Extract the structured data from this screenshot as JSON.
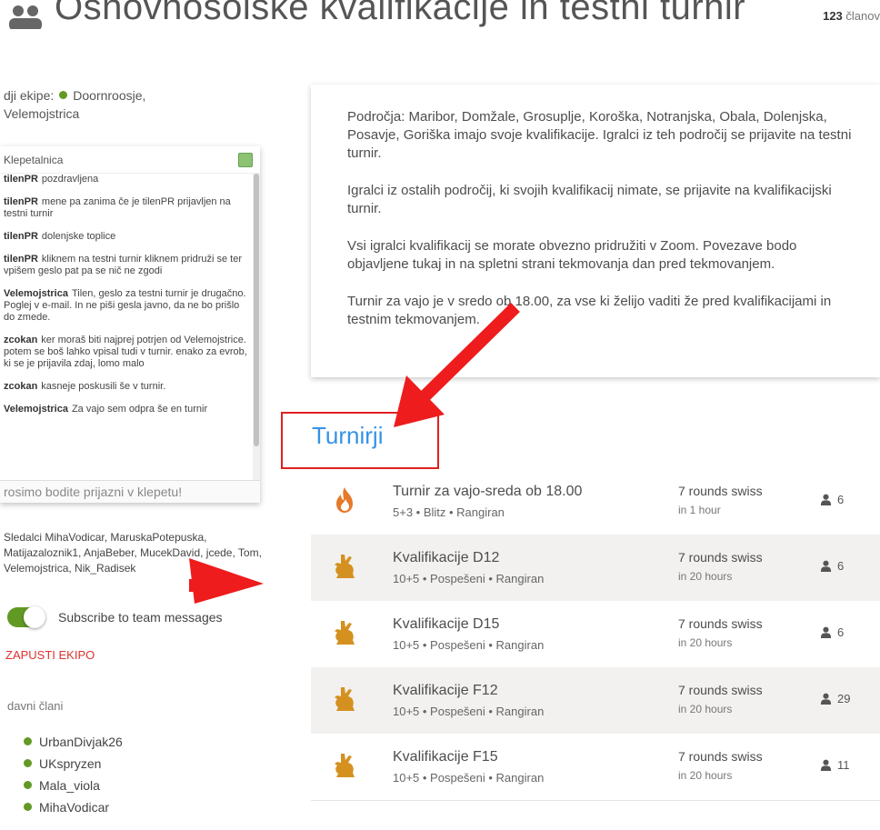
{
  "header": {
    "title": "Osnovnošolske kvalifikacije in testni turnir",
    "members_count": "123",
    "members_suffix": " članov"
  },
  "leaders": {
    "label": "dji ekipe:",
    "names": [
      "Doornroosje,",
      "Velemojstrica"
    ]
  },
  "chat": {
    "title": "Klepetalnica",
    "placeholder": "rosimo bodite prijazni v klepetu!",
    "lines": [
      {
        "user": "tilenPR",
        "text": "pozdravljena"
      },
      {
        "user": "tilenPR",
        "text": "mene pa zanima če je tilenPR prijavljen na testni turnir"
      },
      {
        "user": "tilenPR",
        "text": "dolenjske toplice"
      },
      {
        "user": "tilenPR",
        "text": "kliknem na testni turnir kliknem pridruži se ter vpišem geslo pat pa se nič ne zgodi"
      },
      {
        "user": "Velemojstrica",
        "text": "Tilen, geslo za testni turnir je drugačno. Poglej v e-mail. In ne piši gesla javno, da ne bo prišlo do zmede."
      },
      {
        "user": "zcokan",
        "text": "ker moraš biti najprej potrjen od Velemojstrice. potem se boš lahko vpisal tudi v turnir. enako za evrob, ki se je prijavila zdaj, lomo malo"
      },
      {
        "user": "zcokan",
        "text": "kasneje poskusili še v turnir."
      },
      {
        "user": "Velemojstrica",
        "text": "Za vajo sem odpra še en turnir"
      }
    ]
  },
  "followers": {
    "text": "Sledalci MihaVodicar, MaruskaPotepuska, Matijazaloznik1, AnjaBeber, MucekDavid, jcede, Tom, Velemojstrica, Nik_Radisek"
  },
  "subscribe": {
    "label": "Subscribe to team messages",
    "on": true
  },
  "zapusti": {
    "label": "ZAPUSTI EKIPO"
  },
  "members_section": {
    "title": "davni člani",
    "list": [
      "UrbanDivjak26",
      "UKspryzen",
      "Mala_viola",
      "MihaVodicar"
    ]
  },
  "description": {
    "paragraphs": [
      "Področja: Maribor, Domžale, Grosuplje, Koroška, Notranjska, Obala, Dolenjska, Posavje, Goriška imajo svoje kvalifikacije. Igralci iz teh področij se prijavite na testni turnir.",
      "Igralci iz ostalih področij, ki svojih kvalifikacij nimate, se prijavite na kvalifikacijski turnir.",
      "Vsi igralci kvalifikacij se morate obvezno pridružiti v Zoom. Povezave bodo objavljene tukaj in na spletni strani tekmovanja dan pred tekmovanjem.",
      "Turnir za vajo je v sredo ob 18.00, za vse ki želijo vaditi že pred kvalifikacijami in testnim tekmovanjem."
    ]
  },
  "tournaments": {
    "heading": "Turnirji",
    "colors": {
      "icon": "#d59120",
      "fire": "#e6792b"
    },
    "rows": [
      {
        "icon": "fire-icon",
        "name": "Turnir za vajo-sreda ob 18.00",
        "sub": "5+3 • Blitz • Rangiran",
        "format": "7 rounds swiss",
        "time": "in 1 hour",
        "players": "6"
      },
      {
        "icon": "rabbit-icon",
        "name": "Kvalifikacije D12",
        "sub": "10+5 • Pospešeni • Rangiran",
        "format": "7 rounds swiss",
        "time": "in 20 hours",
        "players": "6"
      },
      {
        "icon": "rabbit-icon",
        "name": "Kvalifikacije D15",
        "sub": "10+5 • Pospešeni • Rangiran",
        "format": "7 rounds swiss",
        "time": "in 20 hours",
        "players": "6"
      },
      {
        "icon": "rabbit-icon",
        "name": "Kvalifikacije F12",
        "sub": "10+5 • Pospešeni • Rangiran",
        "format": "7 rounds swiss",
        "time": "in 20 hours",
        "players": "29"
      },
      {
        "icon": "rabbit-icon",
        "name": "Kvalifikacije F15",
        "sub": "10+5 • Pospešeni • Rangiran",
        "format": "7 rounds swiss",
        "time": "in 20 hours",
        "players": "11"
      }
    ]
  }
}
